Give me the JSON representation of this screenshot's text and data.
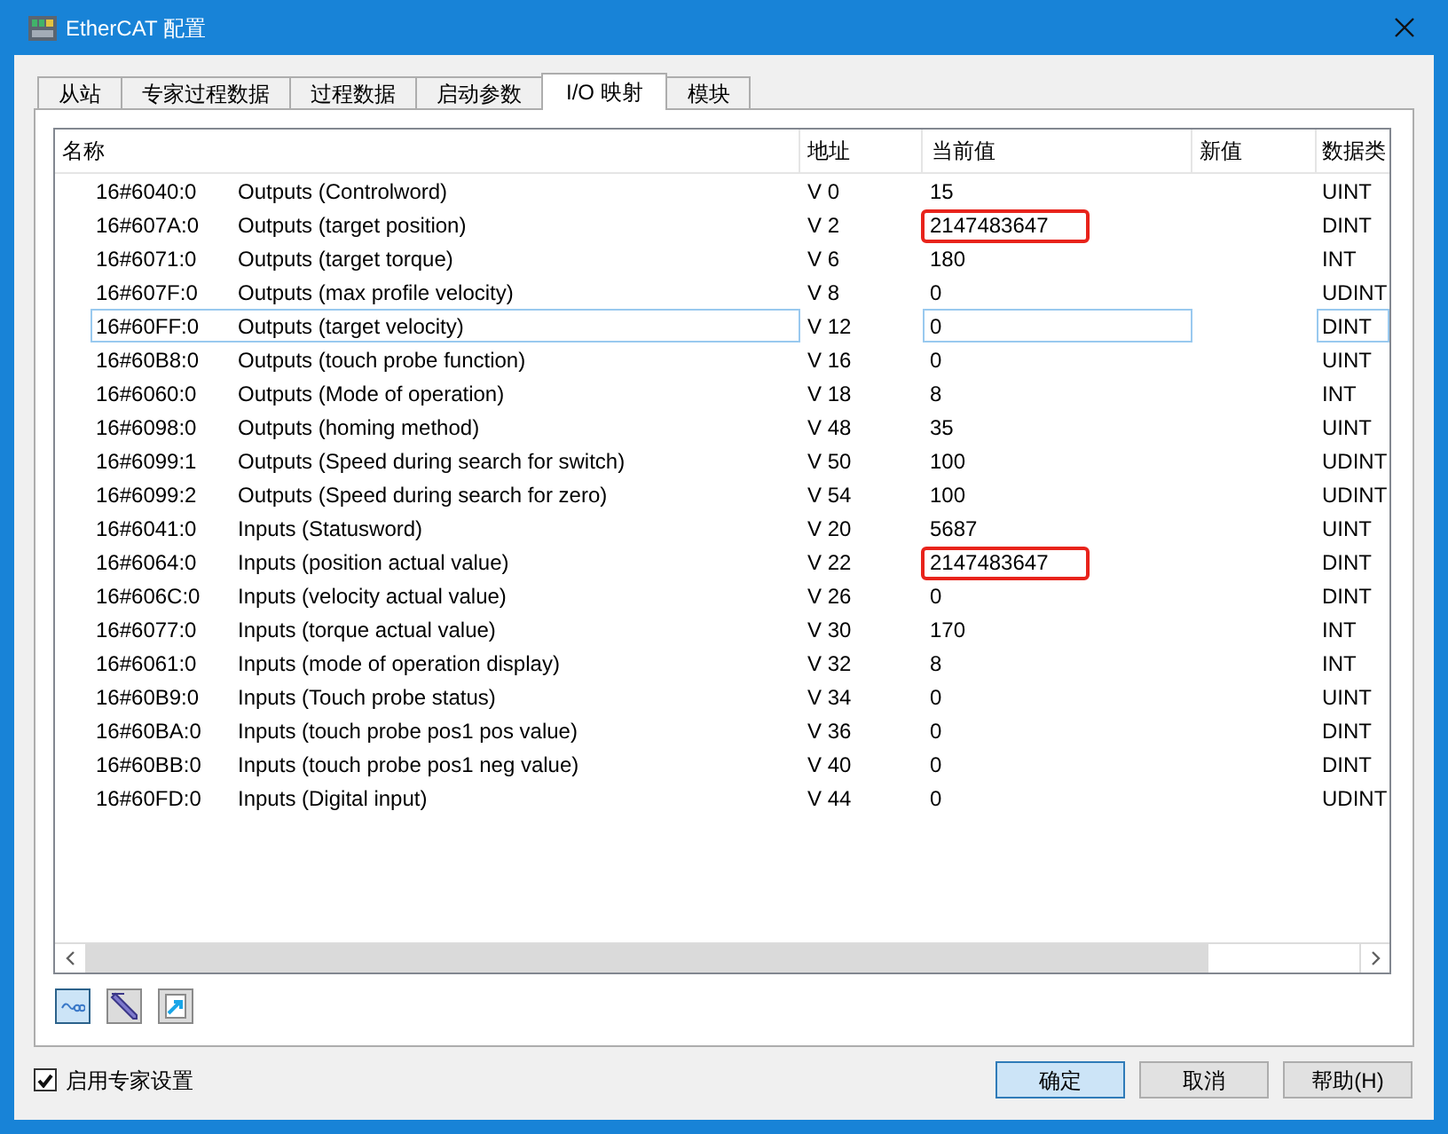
{
  "window": {
    "title": "EtherCAT 配置"
  },
  "tabs": [
    {
      "label": "从站",
      "selected": false
    },
    {
      "label": "专家过程数据",
      "selected": false
    },
    {
      "label": "过程数据",
      "selected": false
    },
    {
      "label": "启动参数",
      "selected": false
    },
    {
      "label": "I/O 映射",
      "selected": true
    },
    {
      "label": "模块",
      "selected": false
    }
  ],
  "table": {
    "columns": [
      "名称",
      "地址",
      "当前值",
      "新值",
      "数据类"
    ],
    "rows": [
      {
        "index": "16#6040:0",
        "name": "Outputs (Controlword)",
        "address": "V 0",
        "current_value": "15",
        "data_type": "UINT",
        "selected": false,
        "highlighted": false
      },
      {
        "index": "16#607A:0",
        "name": "Outputs (target position)",
        "address": "V 2",
        "current_value": "2147483647",
        "data_type": "DINT",
        "selected": false,
        "highlighted": true
      },
      {
        "index": "16#6071:0",
        "name": "Outputs (target torque)",
        "address": "V 6",
        "current_value": "180",
        "data_type": "INT",
        "selected": false,
        "highlighted": false
      },
      {
        "index": "16#607F:0",
        "name": "Outputs (max profile velocity)",
        "address": "V 8",
        "current_value": "0",
        "data_type": "UDINT",
        "selected": false,
        "highlighted": false
      },
      {
        "index": "16#60FF:0",
        "name": "Outputs (target velocity)",
        "address": "V 12",
        "current_value": "0",
        "data_type": "DINT",
        "selected": true,
        "highlighted": false
      },
      {
        "index": "16#60B8:0",
        "name": "Outputs (touch probe function)",
        "address": "V 16",
        "current_value": "0",
        "data_type": "UINT",
        "selected": false,
        "highlighted": false
      },
      {
        "index": "16#6060:0",
        "name": "Outputs (Mode of operation)",
        "address": "V 18",
        "current_value": "8",
        "data_type": "INT",
        "selected": false,
        "highlighted": false
      },
      {
        "index": "16#6098:0",
        "name": "Outputs (homing method)",
        "address": "V 48",
        "current_value": "35",
        "data_type": "UINT",
        "selected": false,
        "highlighted": false
      },
      {
        "index": "16#6099:1",
        "name": "Outputs (Speed during search for switch)",
        "address": "V 50",
        "current_value": "100",
        "data_type": "UDINT",
        "selected": false,
        "highlighted": false
      },
      {
        "index": "16#6099:2",
        "name": "Outputs (Speed during search for zero)",
        "address": "V 54",
        "current_value": "100",
        "data_type": "UDINT",
        "selected": false,
        "highlighted": false
      },
      {
        "index": "16#6041:0",
        "name": "Inputs (Statusword)",
        "address": "V 20",
        "current_value": "5687",
        "data_type": "UINT",
        "selected": false,
        "highlighted": false
      },
      {
        "index": "16#6064:0",
        "name": "Inputs (position actual value)",
        "address": "V 22",
        "current_value": "2147483647",
        "data_type": "DINT",
        "selected": false,
        "highlighted": true
      },
      {
        "index": "16#606C:0",
        "name": "Inputs (velocity actual value)",
        "address": "V 26",
        "current_value": "0",
        "data_type": "DINT",
        "selected": false,
        "highlighted": false
      },
      {
        "index": "16#6077:0",
        "name": "Inputs (torque actual value)",
        "address": "V 30",
        "current_value": "170",
        "data_type": "INT",
        "selected": false,
        "highlighted": false
      },
      {
        "index": "16#6061:0",
        "name": "Inputs (mode of operation display)",
        "address": "V 32",
        "current_value": "8",
        "data_type": "INT",
        "selected": false,
        "highlighted": false
      },
      {
        "index": "16#60B9:0",
        "name": "Inputs (Touch probe status)",
        "address": "V 34",
        "current_value": "0",
        "data_type": "UINT",
        "selected": false,
        "highlighted": false
      },
      {
        "index": "16#60BA:0",
        "name": "Inputs (touch probe pos1 pos value)",
        "address": "V 36",
        "current_value": "0",
        "data_type": "DINT",
        "selected": false,
        "highlighted": false
      },
      {
        "index": "16#60BB:0",
        "name": "Inputs (touch probe pos1 neg value)",
        "address": "V 40",
        "current_value": "0",
        "data_type": "DINT",
        "selected": false,
        "highlighted": false
      },
      {
        "index": "16#60FD:0",
        "name": "Inputs (Digital input)",
        "address": "V 44",
        "current_value": "0",
        "data_type": "UDINT",
        "selected": false,
        "highlighted": false
      }
    ]
  },
  "toolbar": [
    {
      "selected": true
    },
    {
      "selected": false
    },
    {
      "selected": false
    }
  ],
  "expert_settings": {
    "label": "启用专家设置",
    "checked": true
  },
  "buttons": [
    {
      "label": "确定",
      "default": true
    },
    {
      "label": "取消",
      "default": false
    },
    {
      "label": "帮助(H)",
      "default": false
    }
  ]
}
